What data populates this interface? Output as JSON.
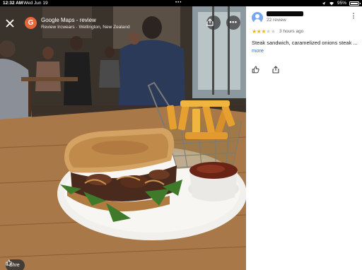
{
  "statusbar": {
    "time": "12:32 AM",
    "date": "Wed Jun 19",
    "dots": "•••",
    "battery": "95%"
  },
  "viewer": {
    "close_icon": "close-icon",
    "source_initial": "G",
    "source_title": "Google Maps - review",
    "source_subtitle": "Review Ircwears · Wellington, New Zealand",
    "share_icon": "share-icon",
    "more_icon": "more-horizontal-icon",
    "more_glyph": "•••",
    "shre_label": "Shre"
  },
  "review": {
    "reviewer_count": "22 review",
    "rating": 3,
    "rating_max": 5,
    "time_ago": "3 hours ago",
    "text": "Steak sandwich, caramelized onions steak ...",
    "more_label": "more",
    "more_glyph": "⋮"
  },
  "colors": {
    "accent_blue": "#1a73e8",
    "star": "#f6b400",
    "source_avatar": "#e8663c",
    "user_avatar": "#7aa7f0"
  }
}
